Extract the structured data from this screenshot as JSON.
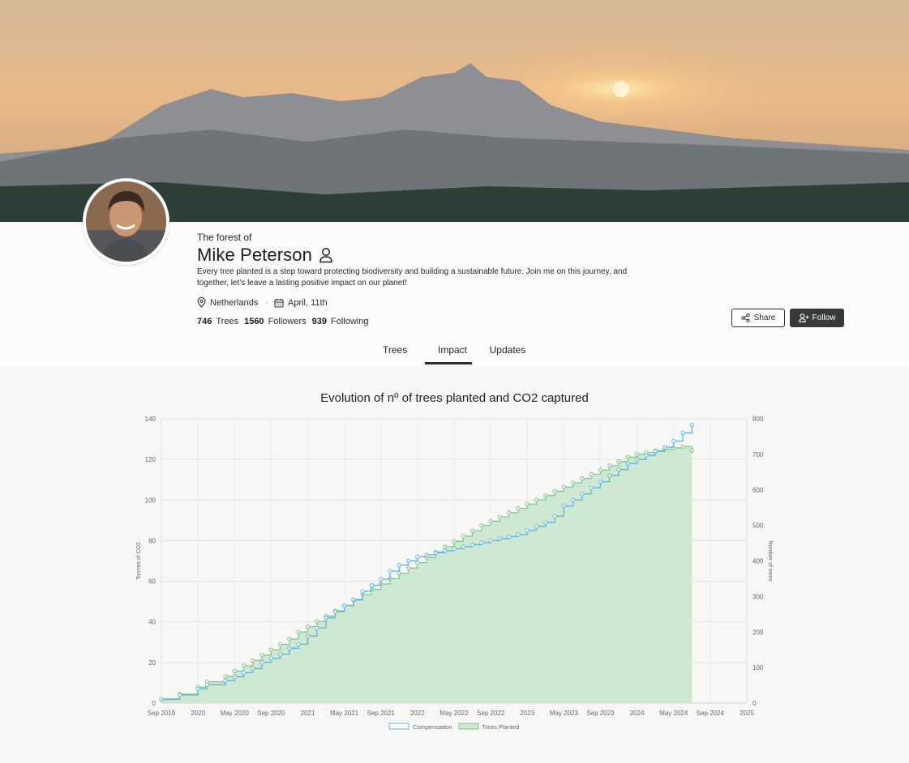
{
  "header": {
    "forest_of": "The forest of",
    "name": "Mike Peterson",
    "bio_line1": "Every tree planted is a step toward protecting biodiversity and building a sustainable future. Join me on this journey, and",
    "bio_line2": "together, let’s leave a lasting positive impact on our planet!",
    "location": "Netherlands",
    "date": "April, 11th",
    "separator": "·"
  },
  "stats": {
    "trees_count": "746",
    "trees_label": "Trees",
    "followers_count": "1560",
    "followers_label": "Followers",
    "following_count": "939",
    "following_label": "Following"
  },
  "actions": {
    "share_label": "Share",
    "follow_label": "Follow"
  },
  "tabs": [
    {
      "label": "Trees",
      "active": false
    },
    {
      "label": "Impact",
      "active": true
    },
    {
      "label": "Updates",
      "active": false
    }
  ],
  "icons": {
    "user": "user-icon",
    "location": "map-pin-icon",
    "calendar": "calendar-icon",
    "share": "share-icon",
    "follow": "user-plus-icon"
  },
  "colors": {
    "compensation": "#64b5e0",
    "trees_fill": "#cfe8d1",
    "trees_line": "#7cc488",
    "button_dark": "#363a38"
  },
  "chart_data": {
    "type": "line",
    "title": "Evolution of nº of trees planted and CO2 captured",
    "ylabel_left": "Tonnes of CO2",
    "ylabel_right": "Number of trees",
    "ylim_left": [
      0,
      140
    ],
    "ylim_right": [
      0,
      800
    ],
    "yticks_left": [
      "0",
      "20",
      "40",
      "60",
      "80",
      "100",
      "120",
      "140"
    ],
    "yticks_right": [
      "0",
      "100",
      "200",
      "300",
      "400",
      "500",
      "600",
      "700",
      "800"
    ],
    "xticks": [
      "Sep 2019",
      "2020",
      "May 2020",
      "Sep 2020",
      "2021",
      "May 2021",
      "Sep 2021",
      "2022",
      "May 2022",
      "Sep 2022",
      "2023",
      "May 2023",
      "Sep 2023",
      "2024",
      "May 2024",
      "Sep 2024",
      "2025"
    ],
    "grid": true,
    "legend_position": "bottom",
    "series": [
      {
        "name": "Compensation",
        "axis": "left",
        "style": "step-line",
        "x": [
          0,
          2,
          4,
          5,
          7,
          8,
          9,
          10,
          11,
          12,
          13,
          14,
          15,
          16,
          17,
          18,
          19,
          20,
          21,
          22,
          23,
          24,
          25,
          26,
          27,
          28,
          29,
          30,
          31,
          32,
          33,
          34,
          35,
          36,
          37,
          38,
          39,
          40,
          41,
          42,
          43,
          44,
          45,
          46,
          47,
          48,
          49,
          50,
          51,
          52,
          53,
          54,
          55,
          56,
          57,
          58
        ],
        "values": [
          2,
          4,
          7,
          9,
          11,
          13,
          15,
          17,
          20,
          22,
          24,
          27,
          29,
          33,
          37,
          42,
          45,
          48,
          51,
          55,
          58,
          61,
          65,
          68,
          70,
          72,
          73,
          74,
          75,
          76,
          77,
          78,
          79,
          80,
          81,
          82,
          83,
          85,
          87,
          89,
          92,
          97,
          100,
          103,
          106,
          109,
          112,
          115,
          118,
          120,
          122,
          124,
          126,
          129,
          133,
          137
        ]
      },
      {
        "name": "Trees Planted",
        "axis": "right",
        "style": "filled-step-area",
        "x": [
          0,
          2,
          4,
          5,
          7,
          8,
          9,
          10,
          11,
          12,
          13,
          14,
          15,
          16,
          17,
          18,
          19,
          20,
          21,
          22,
          23,
          24,
          25,
          26,
          27,
          28,
          29,
          30,
          31,
          32,
          33,
          34,
          35,
          36,
          37,
          38,
          39,
          40,
          41,
          42,
          43,
          44,
          45,
          46,
          47,
          48,
          49,
          50,
          51,
          52,
          53,
          54,
          55,
          56,
          57,
          58
        ],
        "values": [
          10,
          25,
          45,
          60,
          75,
          90,
          105,
          120,
          135,
          150,
          165,
          180,
          200,
          215,
          230,
          245,
          260,
          275,
          290,
          305,
          320,
          335,
          350,
          365,
          380,
          395,
          410,
          425,
          440,
          455,
          470,
          485,
          500,
          512,
          524,
          536,
          548,
          560,
          572,
          584,
          596,
          608,
          620,
          632,
          644,
          656,
          668,
          680,
          692,
          700,
          705,
          710,
          714,
          718,
          722,
          710
        ]
      }
    ],
    "x_unit": "months since Sep 2019"
  }
}
